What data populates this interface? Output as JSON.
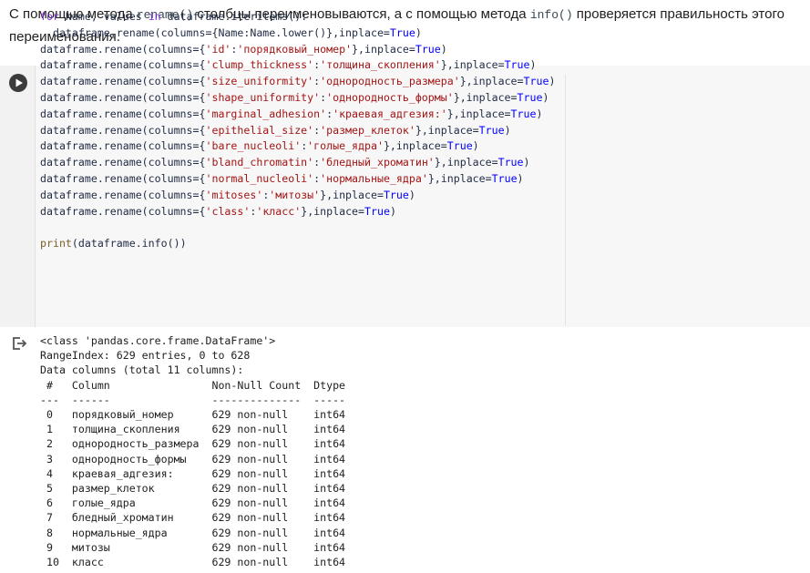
{
  "markdown": {
    "part1": "С помощью метода ",
    "code1": "rename()",
    "part2": " столбцы переименовываются, а с помощью метода ",
    "code2": "info()",
    "part3": " проверяется правильность этого переименования."
  },
  "code_cell": {
    "run_icon": "play-icon",
    "lines": [
      "for Name, values in dataframe.iteritems():",
      "  dataframe.rename(columns={Name:Name.lower()},inplace=True)",
      "dataframe.rename(columns={'id':'порядковый_номер'},inplace=True)",
      "dataframe.rename(columns={'clump_thickness':'толщина_скопления'},inplace=True)",
      "dataframe.rename(columns={'size_uniformity':'однородность_размера'},inplace=True)",
      "dataframe.rename(columns={'shape_uniformity':'однородность_формы'},inplace=True)",
      "dataframe.rename(columns={'marginal_adhesion':'краевая_адгезия:'},inplace=True)",
      "dataframe.rename(columns={'epithelial_size':'размер_клеток'},inplace=True)",
      "dataframe.rename(columns={'bare_nucleoli':'голые_ядра'},inplace=True)",
      "dataframe.rename(columns={'bland_chromatin':'бледный_хроматин'},inplace=True)",
      "dataframe.rename(columns={'normal_nucleoli':'нормальные_ядра'},inplace=True)",
      "dataframe.rename(columns={'mitoses':'митозы'},inplace=True)",
      "dataframe.rename(columns={'class':'класс'},inplace=True)",
      "",
      "print(dataframe.info())"
    ]
  },
  "output": {
    "icon": "output-redirect-icon",
    "lines": [
      "<class 'pandas.core.frame.DataFrame'>",
      "RangeIndex: 629 entries, 0 to 628",
      "Data columns (total 11 columns):",
      " #   Column                Non-Null Count  Dtype",
      "---  ------                --------------  -----",
      " 0   порядковый_номер      629 non-null    int64",
      " 1   толщина_скопления     629 non-null    int64",
      " 2   однородность_размера  629 non-null    int64",
      " 3   однородность_формы    629 non-null    int64",
      " 4   краевая_адгезия:      629 non-null    int64",
      " 5   размер_клеток         629 non-null    int64",
      " 6   голые_ядра            629 non-null    int64",
      " 7   бледный_хроматин      629 non-null    int64",
      " 8   нормальные_ядра       629 non-null    int64",
      " 9   митозы                629 non-null    int64",
      " 10  класс                 629 non-null    int64"
    ]
  }
}
